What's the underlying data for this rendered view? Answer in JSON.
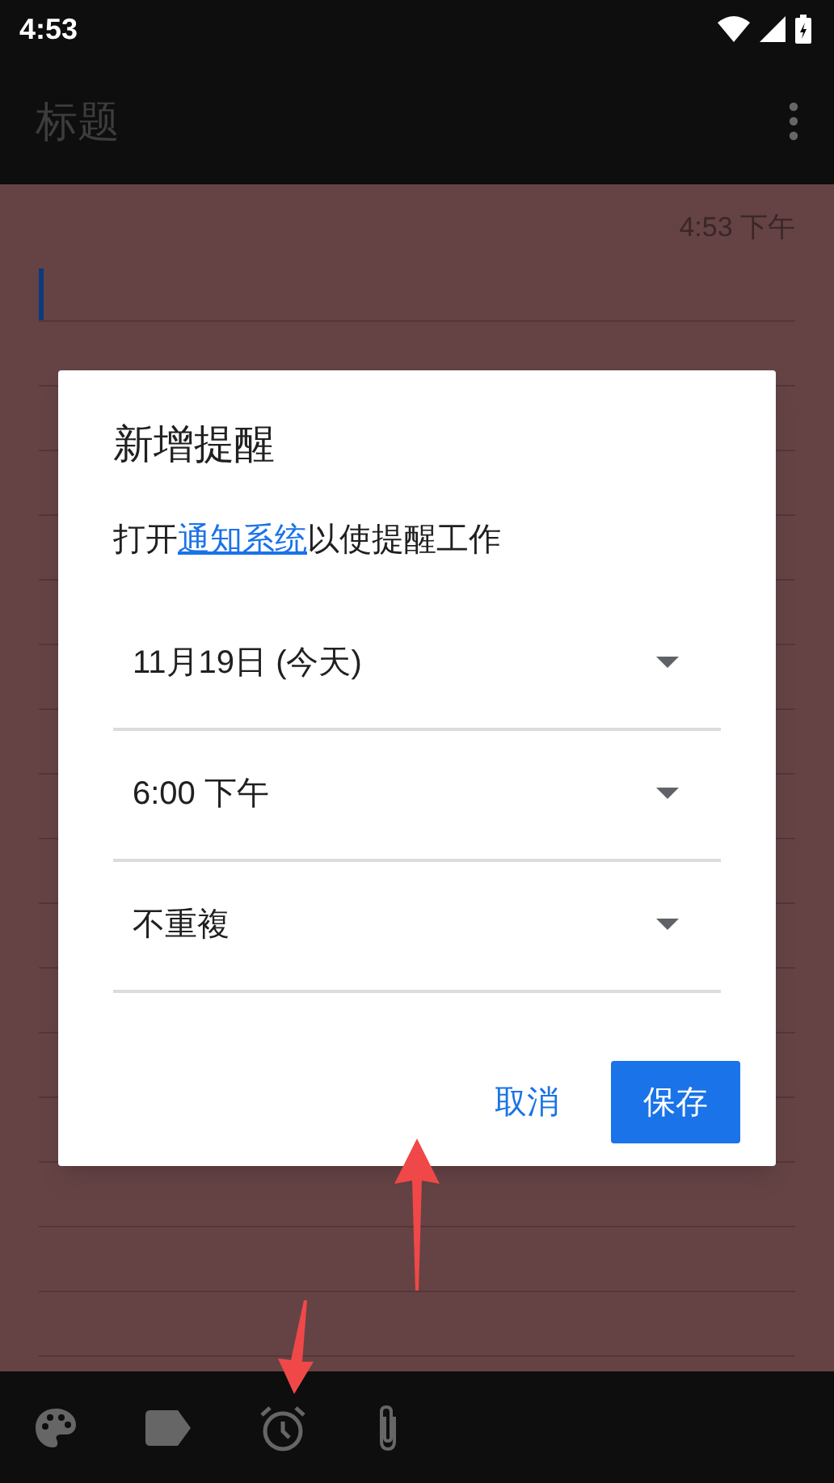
{
  "status_bar": {
    "time": "4:53"
  },
  "app_bar": {
    "title_placeholder": "标题"
  },
  "note": {
    "timestamp": "4:53 下午"
  },
  "dialog": {
    "title": "新增提醒",
    "message_before": "打开",
    "message_link": "通知系统",
    "message_after": "以使提醒工作",
    "fields": [
      {
        "value": "11月19日 (今天)"
      },
      {
        "value": "6:00 下午"
      },
      {
        "value": "不重複"
      }
    ],
    "buttons": [
      {
        "label": "取消",
        "kind": "text"
      },
      {
        "label": "保存",
        "kind": "filled"
      }
    ]
  }
}
